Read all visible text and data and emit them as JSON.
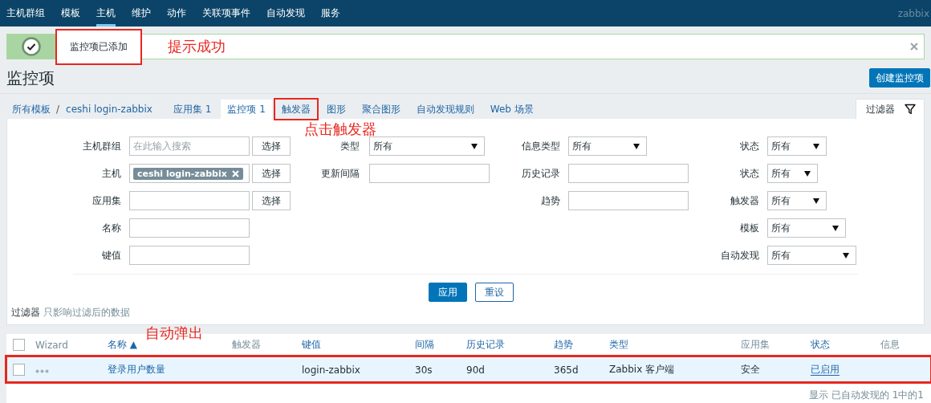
{
  "nav": {
    "items": [
      {
        "label": "主机群组",
        "selected": false
      },
      {
        "label": "模板",
        "selected": false
      },
      {
        "label": "主机",
        "selected": true
      },
      {
        "label": "维护",
        "selected": false
      },
      {
        "label": "动作",
        "selected": false
      },
      {
        "label": "关联项事件",
        "selected": false
      },
      {
        "label": "自动发现",
        "selected": false
      },
      {
        "label": "服务",
        "selected": false
      }
    ],
    "brand": "zabbix"
  },
  "message": {
    "text": "监控项已添加",
    "annotated": true,
    "callout": "提示成功"
  },
  "page": {
    "title": "监控项",
    "create_button": "创建监控项"
  },
  "breadcrumb": {
    "items": [
      "所有模板",
      "ceshi login-zabbix"
    ],
    "separator": "/"
  },
  "tabs": [
    {
      "label": "应用集",
      "count": "1",
      "selected": false,
      "annotated": false
    },
    {
      "label": "监控项",
      "count": "1",
      "selected": true,
      "annotated": false
    },
    {
      "label": "触发器",
      "selected": false,
      "annotated": true,
      "callout": "点击触发器"
    },
    {
      "label": "图形",
      "selected": false,
      "annotated": false
    },
    {
      "label": "聚合图形",
      "selected": false,
      "annotated": false
    },
    {
      "label": "自动发现规则",
      "selected": false,
      "annotated": false
    },
    {
      "label": "Web 场景",
      "selected": false,
      "annotated": false
    }
  ],
  "filter_tab": {
    "label": "过滤器",
    "selected": true
  },
  "filter": {
    "columns": [
      {
        "fields": [
          {
            "label": "主机群组",
            "kind": "multiselect",
            "placeholder": "在此输入搜索",
            "button": "选择"
          },
          {
            "label": "主机",
            "kind": "multiselect",
            "tags": [
              "ceshi login-zabbix"
            ],
            "button": "选择"
          },
          {
            "label": "应用集",
            "kind": "multiselect",
            "button": "选择"
          },
          {
            "label": "名称",
            "kind": "text"
          },
          {
            "label": "键值",
            "kind": "text"
          }
        ]
      },
      {
        "fields": [
          {
            "label": "类型",
            "kind": "select",
            "value": "所有"
          },
          {
            "label": "更新间隔",
            "kind": "text"
          }
        ]
      },
      {
        "fields": [
          {
            "label": "信息类型",
            "kind": "select",
            "value": "所有"
          },
          {
            "label": "历史记录",
            "kind": "text"
          },
          {
            "label": "趋势",
            "kind": "text"
          }
        ]
      },
      {
        "fields": [
          {
            "label": "状态",
            "kind": "select",
            "value": "所有"
          },
          {
            "label": "状态",
            "kind": "select",
            "value": "所有"
          },
          {
            "label": "触发器",
            "kind": "select",
            "value": "所有"
          },
          {
            "label": "模板",
            "kind": "select",
            "value": "所有"
          },
          {
            "label": "自动发现",
            "kind": "select",
            "value": "所有"
          }
        ]
      }
    ],
    "apply": "应用",
    "reset": "重设",
    "note_label": "过滤器",
    "note": "只影响过滤后的数据"
  },
  "table": {
    "columns": [
      {
        "kind": "checkbox",
        "checked": false
      },
      {
        "label": "Wizard",
        "sortable": false
      },
      {
        "label": "名称",
        "sortable": true,
        "sort_indicator": "▲"
      },
      {
        "label": "触发器",
        "sortable": false
      },
      {
        "label": "键值",
        "sortable": true
      },
      {
        "label": "间隔",
        "sortable": true
      },
      {
        "label": "历史记录",
        "sortable": true
      },
      {
        "label": "趋势",
        "sortable": true
      },
      {
        "label": "类型",
        "sortable": true
      },
      {
        "label": "应用集",
        "sortable": false
      },
      {
        "label": "状态",
        "sortable": true
      },
      {
        "label": "信息",
        "sortable": false
      }
    ],
    "rows": [
      {
        "highlighted": true,
        "annotated": true,
        "callout": "自动弹出",
        "cells": [
          {
            "kind": "checkbox",
            "checked": false
          },
          {
            "kind": "wizard"
          },
          {
            "kind": "link",
            "text": "登录用户数量"
          },
          {
            "kind": "empty"
          },
          {
            "kind": "text",
            "text": "login-zabbix"
          },
          {
            "kind": "text",
            "text": "30s"
          },
          {
            "kind": "text",
            "text": "90d"
          },
          {
            "kind": "text",
            "text": "365d"
          },
          {
            "kind": "text",
            "text": "Zabbix 客户端"
          },
          {
            "kind": "text",
            "text": "安全"
          },
          {
            "kind": "status",
            "text": "已启用"
          },
          {
            "kind": "empty"
          }
        ]
      }
    ],
    "footer": "显示 已自动发现的 1中的1"
  }
}
